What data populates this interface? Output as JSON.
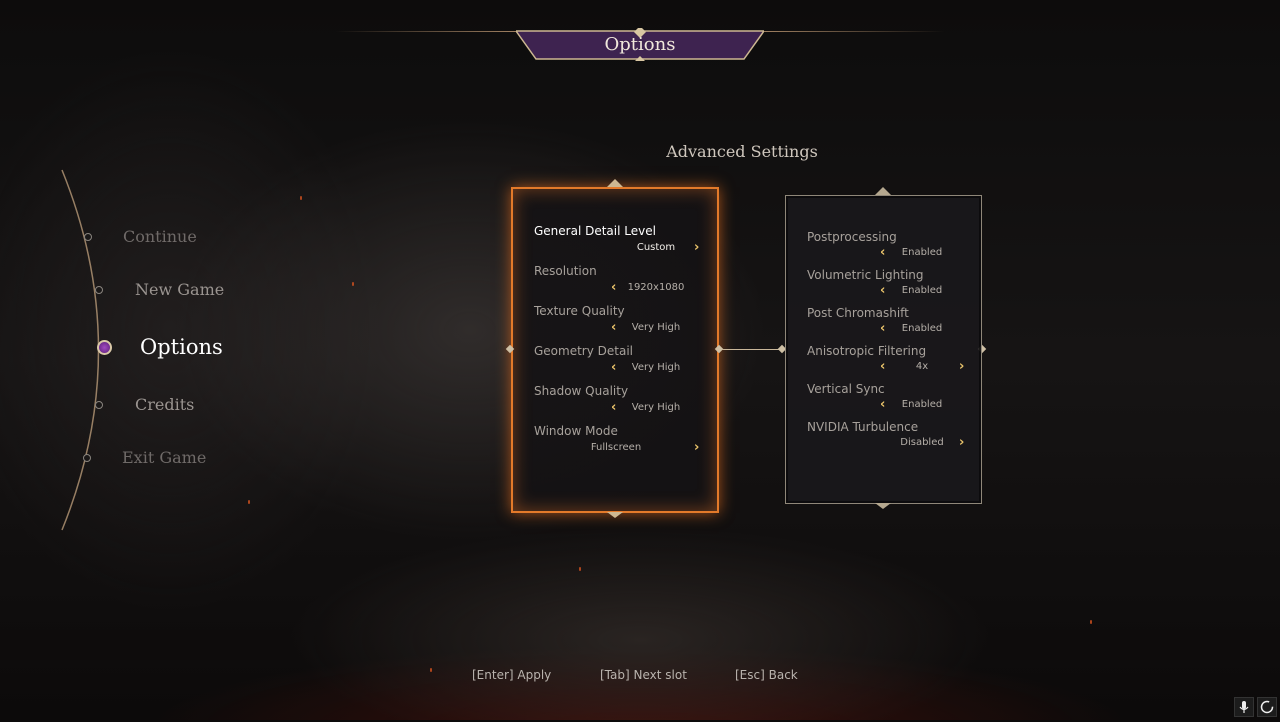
{
  "header": {
    "title": "Options"
  },
  "menu": {
    "items": [
      {
        "label": "Continue"
      },
      {
        "label": "New Game"
      },
      {
        "label": "Options"
      },
      {
        "label": "Credits"
      },
      {
        "label": "Exit Game"
      }
    ],
    "active_index": 2
  },
  "settings": {
    "title": "Advanced Settings",
    "left_panel": [
      {
        "label": "General Detail Level",
        "value": "Custom"
      },
      {
        "label": "Resolution",
        "value": "1920x1080"
      },
      {
        "label": "Texture Quality",
        "value": "Very High"
      },
      {
        "label": "Geometry Detail",
        "value": "Very High"
      },
      {
        "label": "Shadow Quality",
        "value": "Very High"
      },
      {
        "label": "Window Mode",
        "value": "Fullscreen"
      }
    ],
    "right_panel": [
      {
        "label": "Postprocessing",
        "value": "Enabled"
      },
      {
        "label": "Volumetric Lighting",
        "value": "Enabled"
      },
      {
        "label": "Post Chromashift",
        "value": "Enabled"
      },
      {
        "label": "Anisotropic Filtering",
        "value": "4x"
      },
      {
        "label": "Vertical Sync",
        "value": "Enabled"
      },
      {
        "label": "NVIDIA Turbulence",
        "value": "Disabled"
      }
    ]
  },
  "footer": {
    "hints": [
      "[Enter] Apply",
      "[Tab] Next slot",
      "[Esc] Back"
    ]
  },
  "system_icons": [
    "microphone-icon",
    "circle-loader-icon"
  ],
  "colors": {
    "accent_orange": "#e37a2a",
    "arrow_gold": "#e8c26a",
    "banner_purple": "#3e2350",
    "active_dot_purple": "#8a35a8"
  }
}
